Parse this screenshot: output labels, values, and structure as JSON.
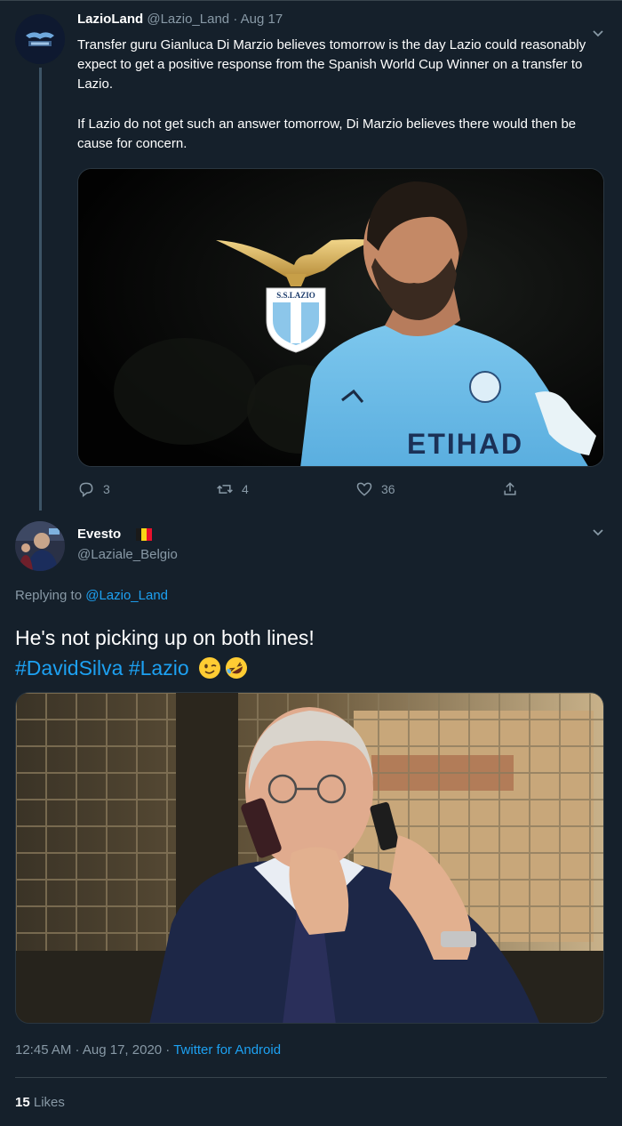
{
  "parent_tweet": {
    "display_name": "LazioLand",
    "handle": "@Lazio_Land",
    "separator": "·",
    "date": "Aug 17",
    "paragraphs": [
      "Transfer guru Gianluca Di Marzio believes tomorrow is the day Lazio could reasonably expect to get a positive response from the Spanish World Cup Winner on a transfer to Lazio.",
      "If Lazio do not get such an answer tomorrow, Di Marzio believes there would then be cause for concern."
    ],
    "media": {
      "crest_label": "S.S.LAZIO",
      "shirt_text": "ETIHAD",
      "icons": [
        "lazio-eagle-crest",
        "player-photo"
      ]
    },
    "actions": {
      "reply_count": "3",
      "retweet_count": "4",
      "like_count": "36",
      "icons": [
        "reply-icon",
        "retweet-icon",
        "like-icon",
        "share-icon"
      ]
    }
  },
  "reply_tweet": {
    "display_name": "Evesto",
    "flag_colors": [
      "#1a1a1a",
      "#f9d616",
      "#e8112d"
    ],
    "handle": "@Laziale_Belgio",
    "replying_prefix": "Replying to",
    "replying_to": "@Lazio_Land",
    "text_main": "He's not picking up on both lines!",
    "hashtags": [
      "#DavidSilva",
      "#Lazio"
    ],
    "emojis": [
      "winking-face-emoji",
      "rolling-on-floor-laughing-emoji"
    ],
    "timestamp": "12:45 AM · Aug 17, 2020",
    "timestamp_sep": " · ",
    "source": "Twitter for Android",
    "likes_count": "15",
    "likes_label": "Likes"
  },
  "colors": {
    "background": "#15202b",
    "accent": "#1da1f2",
    "muted": "#8899a6",
    "divider": "#38444d"
  }
}
